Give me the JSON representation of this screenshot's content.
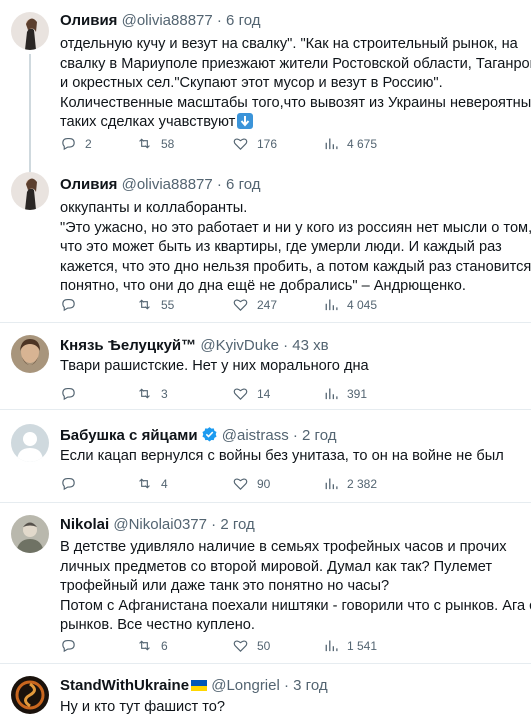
{
  "tweets": [
    {
      "name": "Оливия",
      "handle": "@olivia88877",
      "time": "· 6 год",
      "lines": [
        "отдельную кучу и везут на свалку\". \"Как на строительный рынок, на",
        "свалку в Мариуполе приезжают жители Ростовской области, Таганрога",
        "и окрестных сел.\"Скупают этот мусор и везут в Россию\".",
        "Количественные масштабы того,что вывозят из Украины невероятны. В",
        "таких сделках учавствуют"
      ],
      "emoji": "⬇️",
      "replies": "2",
      "retweets": "58",
      "likes": "176",
      "views": "4 675"
    },
    {
      "name": "Оливия",
      "handle": "@olivia88877",
      "time": "· 6 год",
      "lines": [
        "оккупанты и коллаборанты.",
        "\"Это ужасно, но это работает и ни у кого из россиян нет мысли о том,",
        "что это может быть из квартиры, где умерли люди. И каждый раз",
        "кажется, что это дно нельзя пробить, а потом каждый раз становится",
        "понятно, что они до дна ещё не добрались\" – Андрющенко."
      ],
      "replies": "",
      "retweets": "55",
      "likes": "247",
      "views": "4 045"
    },
    {
      "name": "Князь Ѣелуцкуй™",
      "handle": "@KyivDuke",
      "time": "· 43 хв",
      "lines": [
        "Твари рашистские. Нет у них морального дна"
      ],
      "replies": "",
      "retweets": "3",
      "likes": "14",
      "views": "391"
    },
    {
      "name": "Бабушка с яйцами",
      "handle": "@aistrass",
      "time": "· 2 год",
      "lines": [
        "Если кацап вернулся с войны без унитаза, то он на войне не был"
      ],
      "replies": "",
      "retweets": "4",
      "likes": "90",
      "views": "2 382"
    },
    {
      "name": "Nikolai",
      "handle": "@Nikolai0377",
      "time": "· 2 год",
      "lines": [
        "В детстве удивляло наличие в семьях трофейных часов и прочих",
        "личных предметов со второй мировой. Думал как так? Пулемет",
        "трофейный или даже танк это понятно но часы?",
        "Потом с Афганистана поехали ништяки - говорили что с рынков. Ага с",
        "рынков. Все честно куплено."
      ],
      "replies": "",
      "retweets": "6",
      "likes": "50",
      "views": "1 541"
    },
    {
      "name": "StandWithUkraine",
      "handle": "@Longriel",
      "time": "· 3 год",
      "lines": [
        "Ну и кто тут фашист то?"
      ]
    }
  ],
  "colors": {
    "text": "#0f1419",
    "muted": "#536471",
    "divider": "#e6ecf0",
    "verified": "#1d9bf0",
    "flag_blue": "#0057b7",
    "flag_yellow": "#ffd700"
  },
  "icons": [
    "reply-icon",
    "retweet-icon",
    "like-icon",
    "views-icon",
    "verified-icon",
    "down-arrow-emoji"
  ]
}
